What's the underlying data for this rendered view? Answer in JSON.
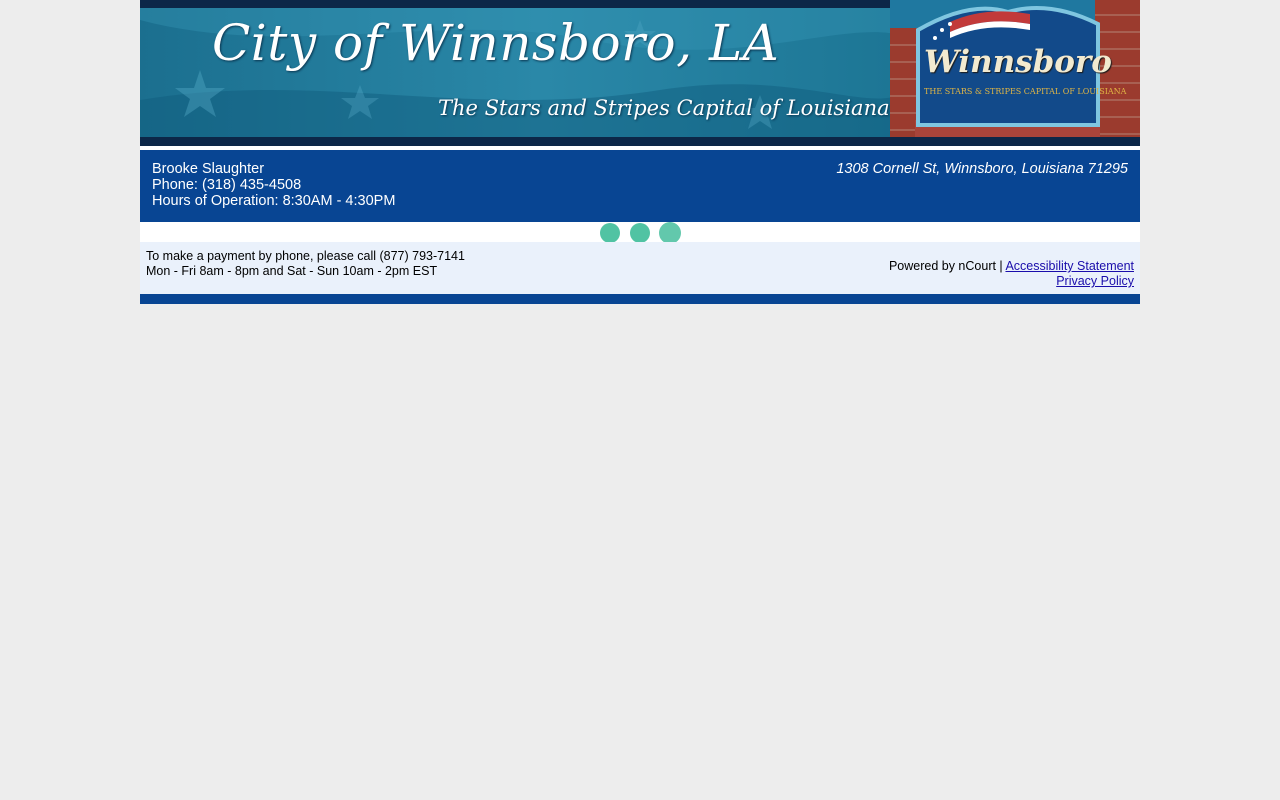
{
  "banner": {
    "title": "City of Winnsboro, LA",
    "tagline": "The Stars and Stripes Capital of Louisiana",
    "sign_text": "Winnsboro",
    "sign_subtext": "THE STARS & STRIPES CAPITAL OF LOUISIANA"
  },
  "info": {
    "name": "Brooke Slaughter",
    "phone": "Phone: (318) 435-4508",
    "hours": "Hours of Operation: 8:30AM - 4:30PM",
    "address": "1308 Cornell St, Winnsboro, Louisiana 71295"
  },
  "footer": {
    "payment_line1": "To make a payment by phone, please call (877) 793-7141",
    "payment_line2": "Mon - Fri 8am - 8pm and Sat - Sun 10am - 2pm EST",
    "powered_by": "Powered by nCourt | ",
    "accessibility_link": "Accessibility Statement",
    "privacy_link": "Privacy Policy"
  },
  "colors": {
    "info_bar": "#084593",
    "footer_bg": "#eaf1fb",
    "loading_dot": "#51c3a3",
    "page_bg": "#ededed",
    "link": "#1a0dab"
  }
}
